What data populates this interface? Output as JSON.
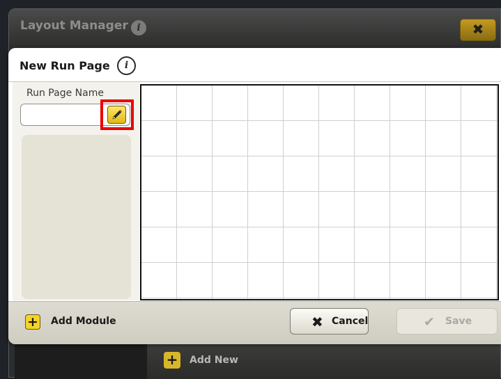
{
  "background_window": {
    "title": "Layout Manager",
    "info_icon": "info-icon",
    "close_label": "✖",
    "add_new_icon_label": "+",
    "add_new_label": "Add New"
  },
  "dialog": {
    "title": "New Run Page",
    "info_icon_label": "i",
    "run_page_name_label": "Run Page Name",
    "name_input_value": "",
    "edit_icon": "pencil-icon",
    "add_module_icon_label": "+",
    "add_module_label": "Add Module",
    "cancel_icon_label": "✖",
    "cancel_label": "Cancel",
    "save_icon_label": "✔",
    "save_label": "Save"
  },
  "colors": {
    "accent_yellow": "#f5d425",
    "highlight_red": "#ec0000",
    "dark_background": "#2b2d2f"
  }
}
